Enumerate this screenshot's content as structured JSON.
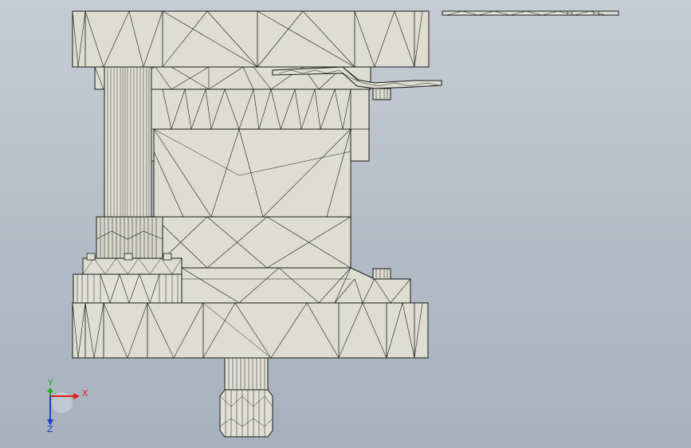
{
  "viewport": {
    "background_top": "#c6ccd3",
    "background_bottom": "#a7b1bd"
  },
  "model": {
    "face_color": "#ddddd2",
    "shade_color": "#c8c8bc",
    "edge_color": "#1a1a1a"
  },
  "triad": {
    "x_label": "X",
    "y_label": "Y",
    "z_label": "Z",
    "x_color": "#e02020",
    "y_color": "#20b020",
    "z_color": "#2040d0"
  }
}
